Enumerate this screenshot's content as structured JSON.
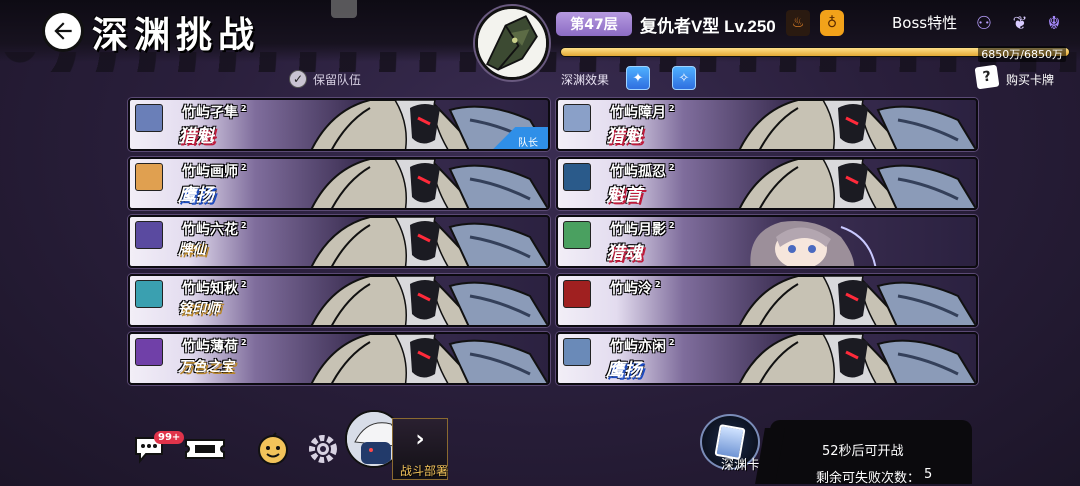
{
  "header": {
    "title": "深渊挑战",
    "floor": "第47层",
    "boss_name": "复仇者V型",
    "boss_level": "Lv.250",
    "boss_traits_label": "Boss特性",
    "hp_text": "6850万/6850万",
    "hp_fraction": 1.0,
    "abyss_effect_label": "深渊效果",
    "buy_card_label": "购买卡牌",
    "keep_team_label": "保留队伍",
    "keep_team_checked": true
  },
  "team_left": [
    {
      "name": "竹屿孑隼",
      "level": "2",
      "title": "猎魁",
      "style": "red",
      "portrait": "#6a7fb8",
      "leader": true
    },
    {
      "name": "竹屿画师",
      "level": "2",
      "title": "鹰扬",
      "style": "blue",
      "portrait": "#e0a050",
      "leader": false
    },
    {
      "name": "竹屿六花",
      "level": "2",
      "title": "牌仙",
      "style": "gold",
      "portrait": "#5a4aa0",
      "leader": false
    },
    {
      "name": "竹屿知秋",
      "level": "2",
      "title": "铭印师",
      "style": "gold",
      "portrait": "#3aa0b0",
      "leader": false
    },
    {
      "name": "竹屿薄荷",
      "level": "2",
      "title": "万色之宝",
      "style": "gold",
      "portrait": "#7040a8",
      "leader": false
    }
  ],
  "team_right": [
    {
      "name": "竹屿障月",
      "level": "2",
      "title": "猎魁",
      "style": "red",
      "portrait": "#8aa0c8",
      "special": false
    },
    {
      "name": "竹屿孤忍",
      "level": "2",
      "title": "魁首",
      "style": "red",
      "portrait": "#2a5a8a",
      "special": false
    },
    {
      "name": "竹屿月影",
      "level": "2",
      "title": "猎魂",
      "style": "red",
      "portrait": "#4aa060",
      "special": true
    },
    {
      "name": "竹屿泠",
      "level": "2",
      "title": "",
      "style": "red",
      "portrait": "#a02020",
      "special": false
    },
    {
      "name": "竹屿亦闲",
      "level": "2",
      "title": "鹰扬",
      "style": "blue",
      "portrait": "#6a8ab8",
      "special": false
    }
  ],
  "leader_tag": "队长",
  "bottom": {
    "chat_badge": "99+",
    "deploy_label": "战斗部署",
    "abyss_card_label": "深渊卡",
    "countdown": "52秒后可开战",
    "fail_label": "剩余可失败次数：",
    "fail_count": "5"
  },
  "colors": {
    "accent": "#e3a935",
    "background": "#2a1f3c",
    "floor_badge": "#8c6cc4",
    "effect_icon": "#2f6fe0"
  },
  "icons": [
    "back-arrow-icon",
    "boss-portrait-icon",
    "flame-icon",
    "gourd-icon",
    "trait-bat-icon",
    "trait-lotus-icon",
    "trait-dragon-icon",
    "effect-icon",
    "card-icon",
    "chat-icon",
    "ticket-icon",
    "smile-face-icon",
    "gear-icon",
    "chevron-right-icon"
  ]
}
